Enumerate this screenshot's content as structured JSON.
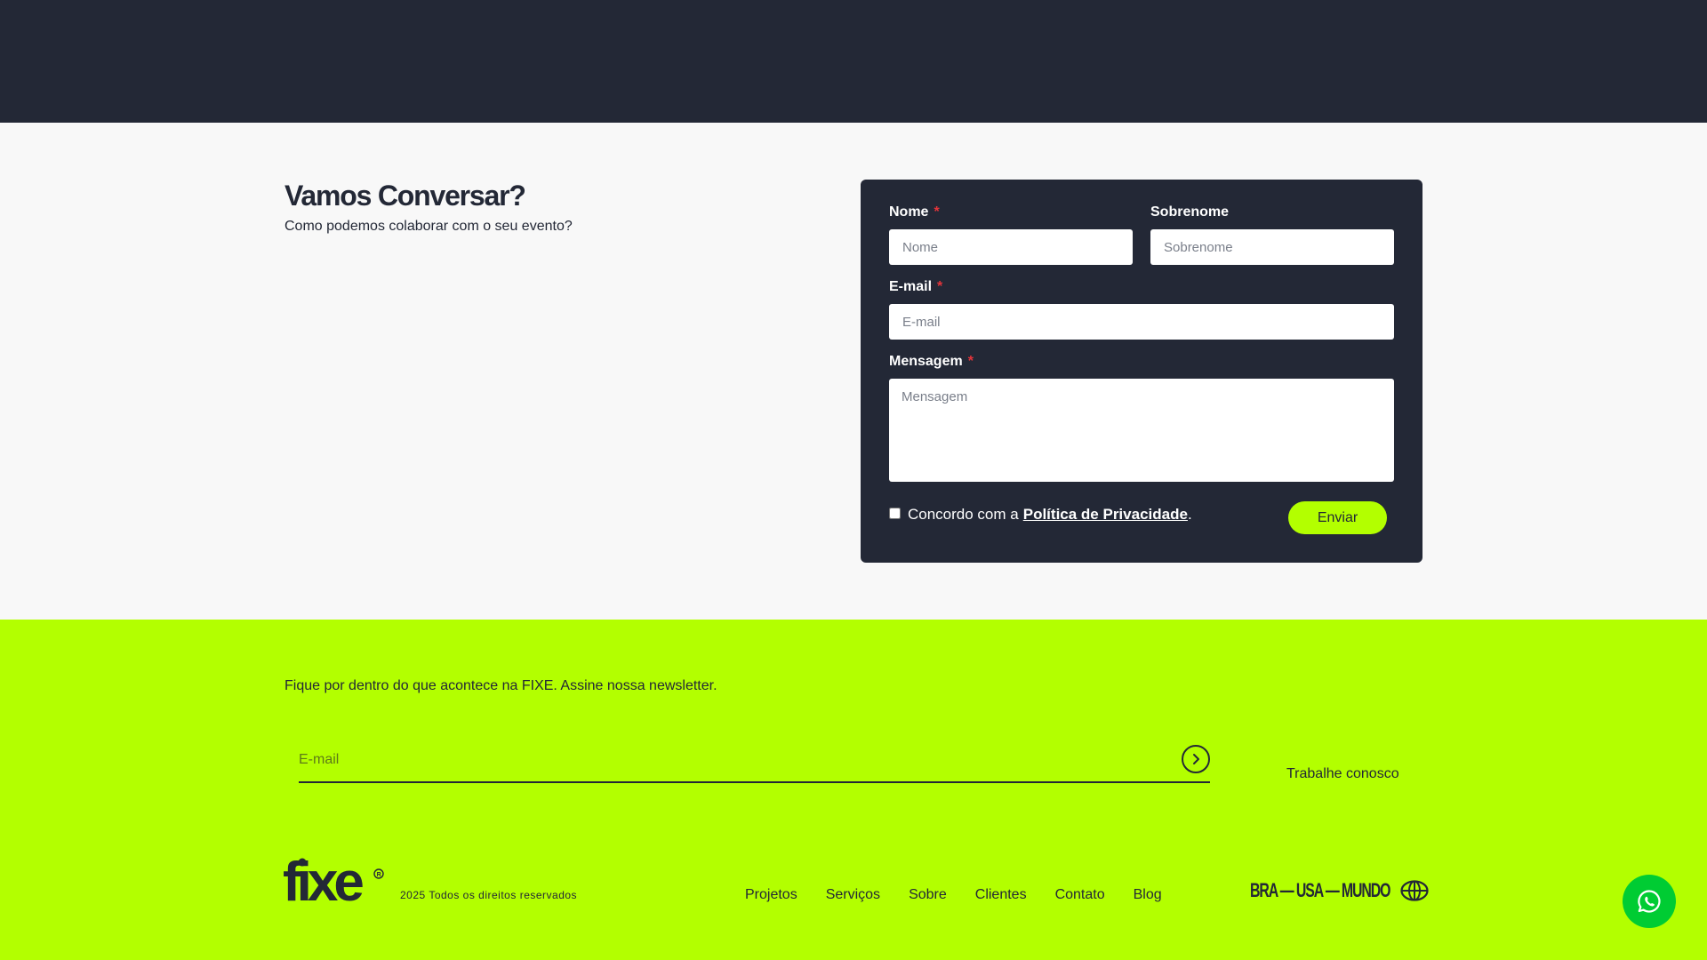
{
  "contact": {
    "title": "Vamos Conversar?",
    "subtitle": "Como podemos colaborar com o seu evento?"
  },
  "form": {
    "first_name_label": "Nome",
    "first_name_placeholder": "Nome",
    "last_name_label": "Sobrenome",
    "last_name_placeholder": "Sobrenome",
    "email_label": "E-mail",
    "email_placeholder": "E-mail",
    "message_label": "Mensagem",
    "message_placeholder": "Mensagem",
    "required_mark": "*",
    "consent_text": "Concordo com a",
    "privacy_link": "Política de Privacidade",
    "consent_suffix": ".",
    "submit_label": "Enviar"
  },
  "footer": {
    "newsletter_text": "Fique por dentro do que acontece na FIXE. Assine nossa newsletter.",
    "newsletter_placeholder": "E-mail",
    "work_with_us": "Trabalhe conosco",
    "logo_text": "fixe",
    "copyright": "2025 Todos os direitos reservados",
    "nav": [
      "Projetos",
      "Serviços",
      "Sobre",
      "Clientes",
      "Contato",
      "Blog"
    ],
    "locations": "BRA — USA — MUNDO"
  },
  "colors": {
    "dark": "#232836",
    "accent": "#b3ff00",
    "whatsapp": "#00cc33",
    "required": "#e5343a"
  },
  "icons": [
    "arrow-right-circle-icon",
    "globe-icon",
    "whatsapp-icon",
    "registered-icon"
  ]
}
